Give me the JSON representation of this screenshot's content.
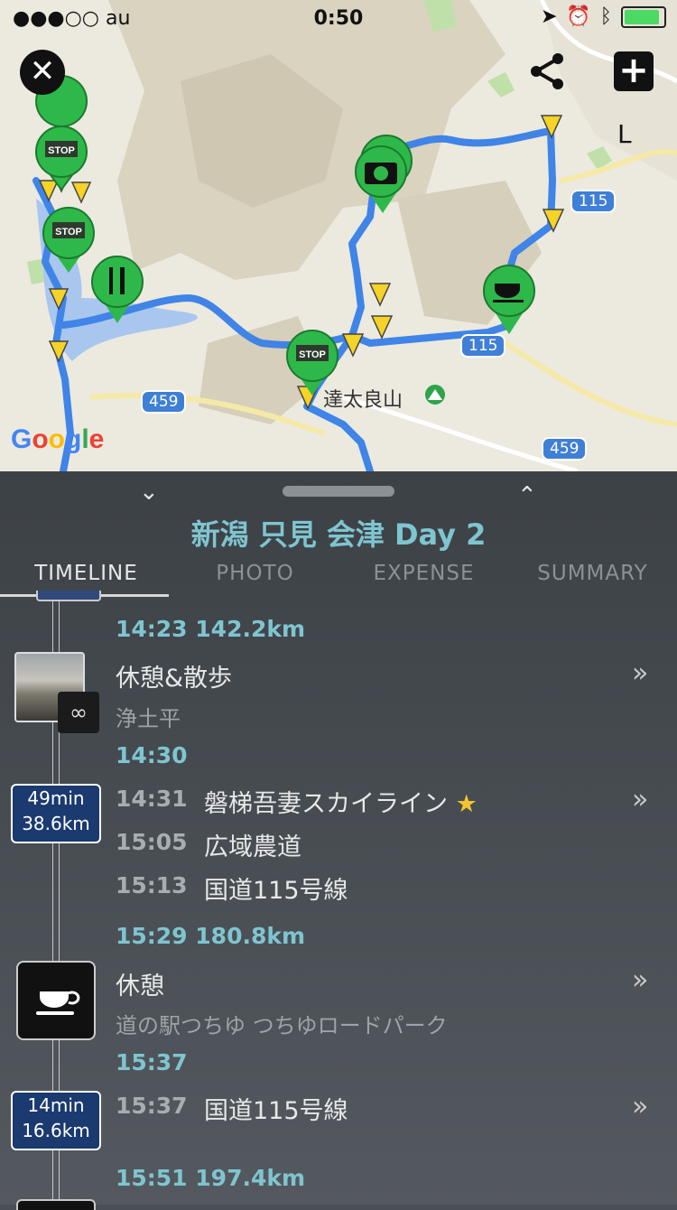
{
  "status_bar": {
    "carrier": "●●●○○ au",
    "time": "0:50",
    "icons": [
      "wifi-icon",
      "location-arrow-icon",
      "alarm-icon",
      "bluetooth-icon",
      "battery-icon"
    ],
    "battery_level": 0.95,
    "battery_color": "#4cd964"
  },
  "map": {
    "scale_label": "L",
    "place_label": "達太良山",
    "route_shields": [
      "115",
      "115",
      "459",
      "459"
    ],
    "google_logo": "Google",
    "route_color": "#3f84e6",
    "marker_color": "#2fb84a"
  },
  "toolbar": {
    "close_icon": "close-icon",
    "share_icon": "share-icon",
    "add_icon": "plus-icon"
  },
  "sheet": {
    "title": "新潟 只見 会津 Day 2",
    "tabs": [
      {
        "label": "TIMELINE",
        "active": true
      },
      {
        "label": "PHOTO",
        "active": false
      },
      {
        "label": "EXPENSE",
        "active": false
      },
      {
        "label": "SUMMARY",
        "active": false
      }
    ]
  },
  "timeline": {
    "stop1": {
      "time_km": "14:23  142.2km",
      "title": "休憩&散歩",
      "place": "浄土平",
      "end_time": "14:30",
      "more": "»"
    },
    "segment1": {
      "duration": "49min",
      "distance": "38.6km",
      "rows": [
        {
          "time": "14:31",
          "road": "磐梯吾妻スカイライン",
          "star": "★"
        },
        {
          "time": "15:05",
          "road": "広域農道",
          "star": ""
        },
        {
          "time": "15:13",
          "road": "国道115号線",
          "star": ""
        }
      ],
      "more": "»"
    },
    "stop2": {
      "time_km": "15:29  180.8km",
      "title": "休憩",
      "place": "道の駅つちゆ つちゆロードパーク",
      "end_time": "15:37",
      "more": "»"
    },
    "segment2": {
      "duration": "14min",
      "distance": "16.6km",
      "rows": [
        {
          "time": "15:37",
          "road": "国道115号線"
        }
      ],
      "more": "»"
    },
    "next": {
      "time_km": "15:51  197.4km"
    }
  }
}
